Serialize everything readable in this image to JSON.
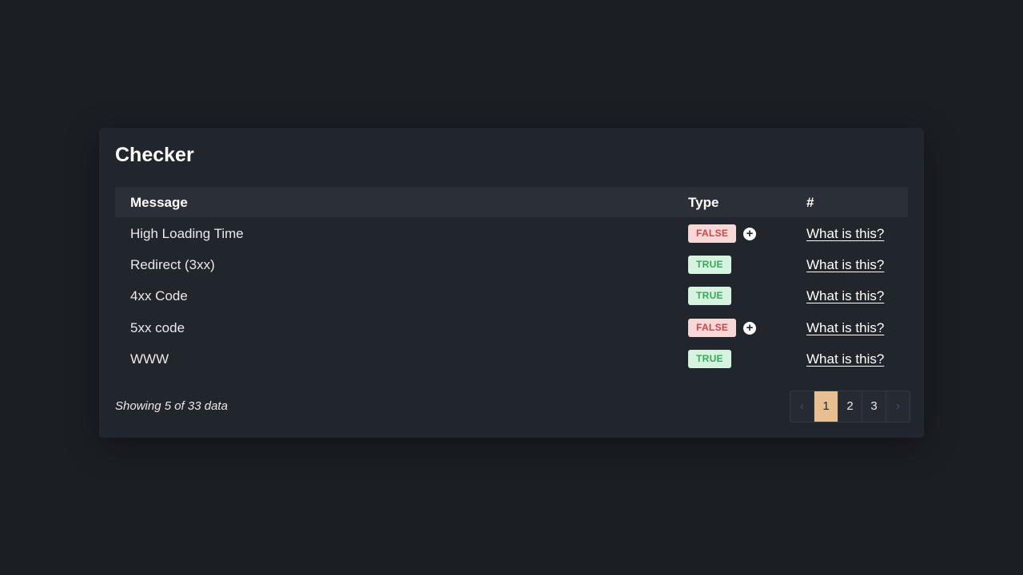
{
  "card": {
    "title": "Checker"
  },
  "table": {
    "headers": {
      "message": "Message",
      "type": "Type",
      "hash": "#"
    },
    "rows": [
      {
        "message": "High Loading Time",
        "type": "FALSE",
        "status": "false",
        "has_expand": true,
        "link": "What is this?"
      },
      {
        "message": "Redirect (3xx)",
        "type": "TRUE",
        "status": "true",
        "has_expand": false,
        "link": "What is this?"
      },
      {
        "message": "4xx Code",
        "type": "TRUE",
        "status": "true",
        "has_expand": false,
        "link": "What is this?"
      },
      {
        "message": "5xx code",
        "type": "FALSE",
        "status": "false",
        "has_expand": true,
        "link": "What is this?"
      },
      {
        "message": "WWW",
        "type": "TRUE",
        "status": "true",
        "has_expand": false,
        "link": "What is this?"
      }
    ]
  },
  "footer": {
    "summary": "Showing 5 of 33 data",
    "pagination": {
      "prev": "‹",
      "pages": [
        "1",
        "2",
        "3"
      ],
      "current": "1",
      "next": "›"
    }
  },
  "icons": {
    "expand": "+"
  },
  "colors": {
    "accent_page": "#e8bf8f",
    "false_bg": "#f8d7d7",
    "false_fg": "#c94848",
    "true_bg": "#d6f3df",
    "true_fg": "#39a85c"
  }
}
